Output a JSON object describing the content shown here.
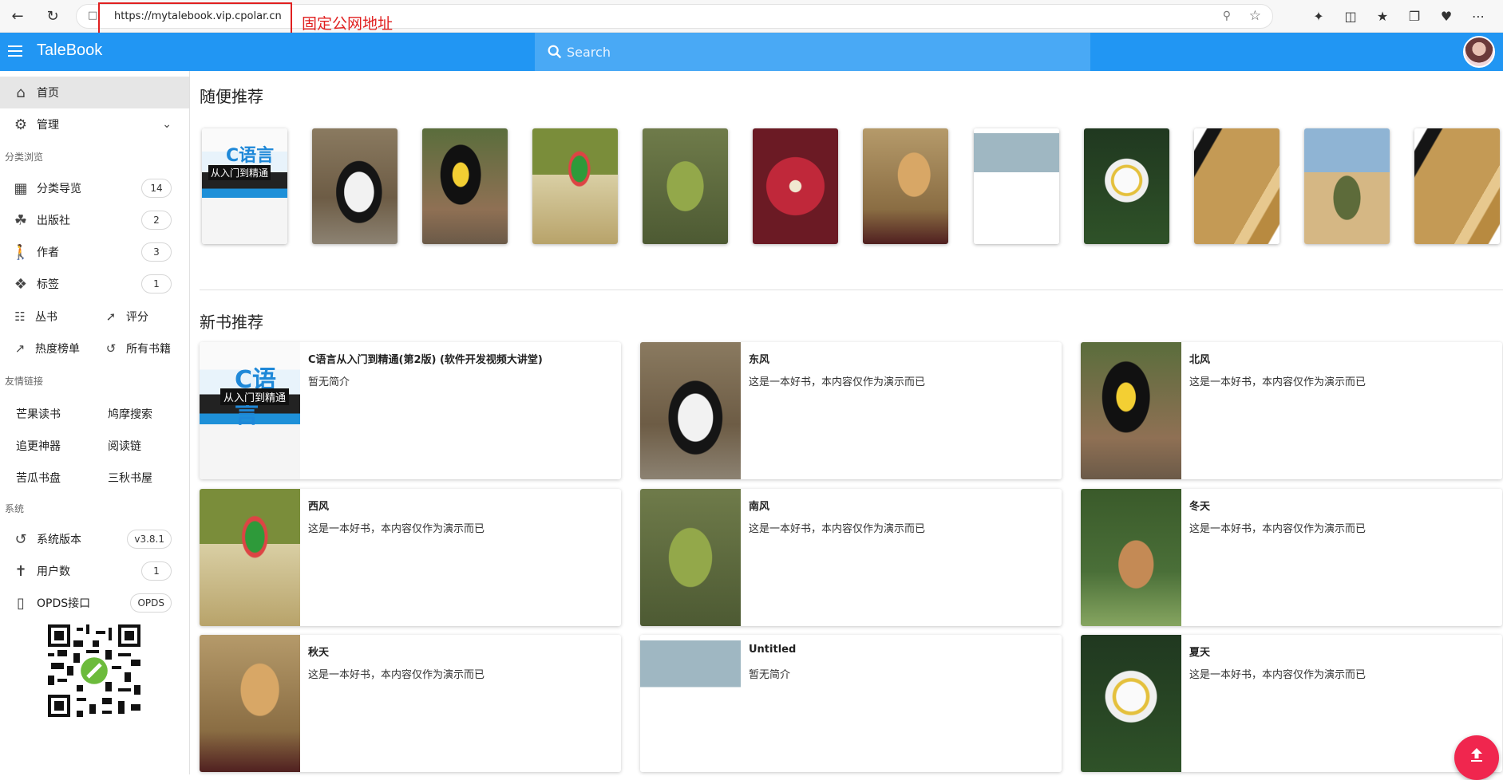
{
  "browser": {
    "url": "https://mytalebook.vip.cpolar.cn",
    "annotation": "固定公网地址"
  },
  "appbar": {
    "title": "TaleBook",
    "search_placeholder": "Search",
    "brand_color": "#2196f3"
  },
  "sidebar": {
    "home": "首页",
    "manage": "管理",
    "browse_header": "分类浏览",
    "browse": [
      {
        "label": "分类导览",
        "count": "14",
        "icon": "category-icon"
      },
      {
        "label": "出版社",
        "count": "2",
        "icon": "publisher-icon"
      },
      {
        "label": "作者",
        "count": "3",
        "icon": "author-icon"
      },
      {
        "label": "标签",
        "count": "1",
        "icon": "tag-icon"
      }
    ],
    "series": "丛书",
    "rating": "评分",
    "hot": "热度榜单",
    "all_books": "所有书籍",
    "links_header": "友情链接",
    "links": [
      "芒果读书",
      "鸠摩搜索",
      "追更神器",
      "阅读链",
      "苦瓜书盘",
      "三秋书屋"
    ],
    "system_header": "系统",
    "system": [
      {
        "label": "系统版本",
        "value": "v3.8.1",
        "icon": "history-icon"
      },
      {
        "label": "用户数",
        "value": "1",
        "icon": "user-icon"
      },
      {
        "label": "OPDS接口",
        "value": "OPDS",
        "icon": "phone-icon"
      }
    ]
  },
  "main": {
    "random_title": "随便推荐",
    "new_title": "新书推荐",
    "books": [
      {
        "title": "C语言从入门到精通(第2版) (软件开发视频大讲堂)",
        "desc": "暂无简介"
      },
      {
        "title": "东风",
        "desc": "这是一本好书，本内容仅作为演示而已"
      },
      {
        "title": "北风",
        "desc": "这是一本好书，本内容仅作为演示而已"
      },
      {
        "title": "西风",
        "desc": "这是一本好书，本内容仅作为演示而已"
      },
      {
        "title": "南风",
        "desc": "这是一本好书，本内容仅作为演示而已"
      },
      {
        "title": "冬天",
        "desc": "这是一本好书，本内容仅作为演示而已"
      },
      {
        "title": "秋天",
        "desc": "这是一本好书，本内容仅作为演示而已"
      },
      {
        "title": "Untitled",
        "desc": "暂无简介"
      },
      {
        "title": "夏天",
        "desc": "这是一本好书，本内容仅作为演示而已"
      }
    ]
  },
  "cover_text": {
    "c_line1": "C语言",
    "c_line2": "从入门到精通"
  },
  "fab_color": "#f0264e"
}
